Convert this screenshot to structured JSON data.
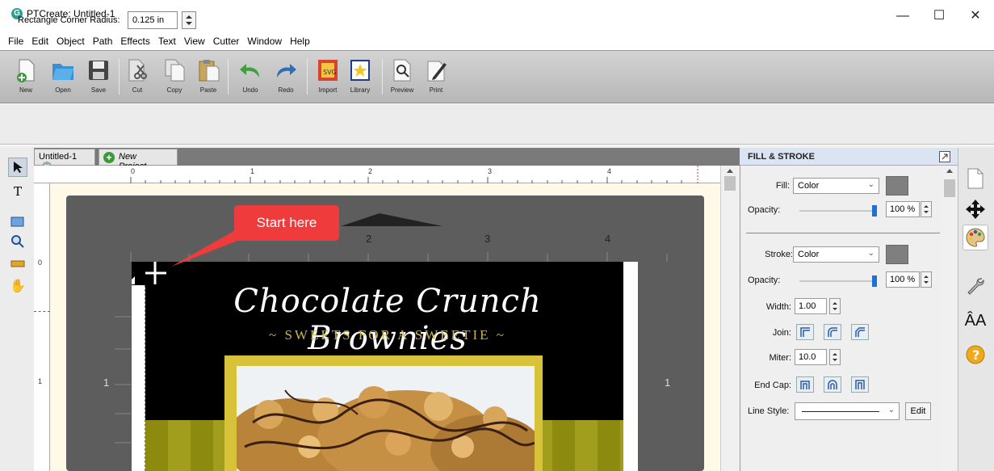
{
  "window": {
    "title": "PTCreate: Untitled-1",
    "app_icon": "G",
    "minimize": "—",
    "maximize": "☐",
    "close": "✕"
  },
  "menu": [
    "File",
    "Edit",
    "Object",
    "Path",
    "Effects",
    "Text",
    "View",
    "Cutter",
    "Window",
    "Help"
  ],
  "toolbar": {
    "new": "New",
    "open": "Open",
    "save": "Save",
    "cut": "Cut",
    "copy": "Copy",
    "paste": "Paste",
    "undo": "Undo",
    "redo": "Redo",
    "import": "Import",
    "library": "Library",
    "preview": "Preview",
    "print": "Print"
  },
  "property_bar": {
    "label": "Rectangle Corner Radius:",
    "value": "0.125 in"
  },
  "tabs": {
    "doc": "Untitled-1",
    "new_project": "New Project..."
  },
  "ruler_top": [
    "0",
    "1",
    "2",
    "3",
    "4"
  ],
  "ruler_left": [
    "0",
    "1"
  ],
  "design": {
    "title": "Chocolate Crunch Brownies",
    "subtitle": "~ SWEETS FOR A SWEETIE ~",
    "mat_ruler": [
      "2",
      "3",
      "4"
    ],
    "mat_side": "1"
  },
  "callout": "Start here",
  "panel": {
    "title": "FILL & STROKE",
    "fill_label": "Fill:",
    "fill_value": "Color",
    "opacity_label": "Opacity:",
    "fill_opacity": "100 %",
    "stroke_label": "Stroke:",
    "stroke_value": "Color",
    "stroke_opacity": "100 %",
    "width_label": "Width:",
    "width_value": "1.00",
    "join_label": "Join:",
    "miter_label": "Miter:",
    "miter_value": "10.0",
    "endcap_label": "End Cap:",
    "linestyle_label": "Line Style:",
    "edit": "Edit"
  },
  "colors": {
    "accent_blue": "#1f6fd6",
    "callout_red": "#ef3b3b",
    "mat_gray": "#5d5d5d",
    "subtitle_gold": "#c8b44a"
  }
}
